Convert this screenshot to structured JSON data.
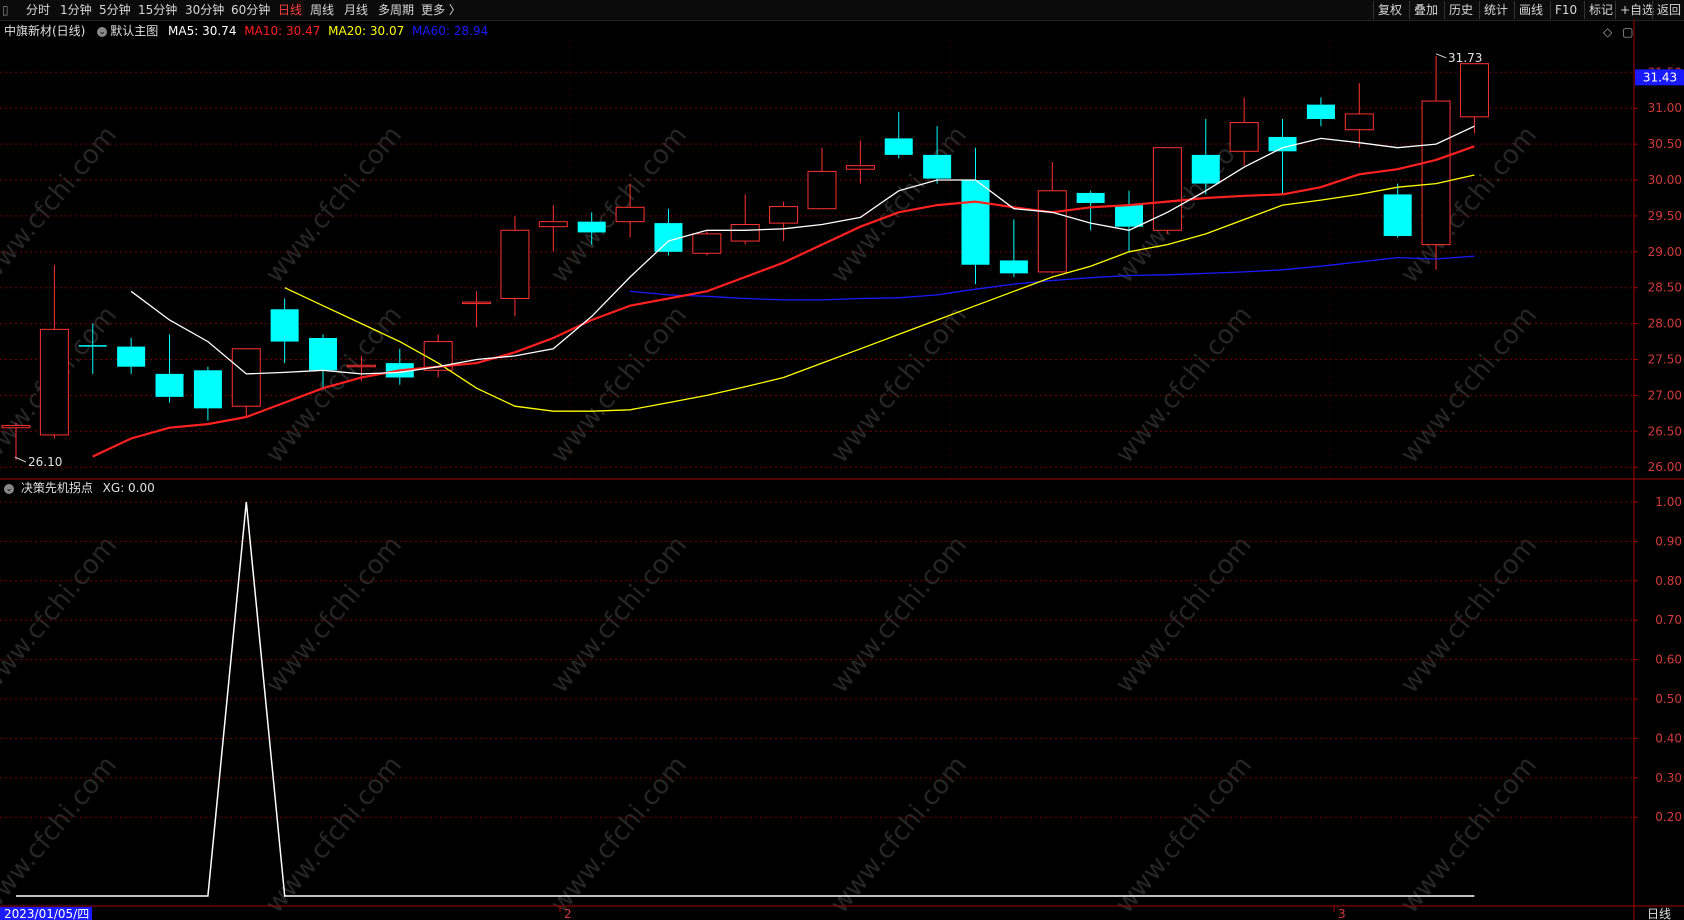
{
  "toolbar": {
    "left_tabs": [
      "分时",
      "1分钟",
      "5分钟",
      "15分钟",
      "30分钟",
      "60分钟",
      "日线",
      "周线",
      "月线",
      "多周期",
      "更多 〉"
    ],
    "active_tab": "日线",
    "right_buttons": [
      "复权",
      "叠加",
      "历史",
      "统计",
      "画线",
      "F10",
      "标记",
      "+自选",
      "返回"
    ]
  },
  "main_chart": {
    "stock_label": "中旗新材(日线)",
    "template_label": "默认主图",
    "ma5": {
      "label": "MA5: 30.74",
      "color": "#ffffff"
    },
    "ma10": {
      "label": "MA10: 30.47",
      "color": "#ff2020"
    },
    "ma20": {
      "label": "MA20: 30.07",
      "color": "#ffff00"
    },
    "ma60": {
      "label": "MA60: 28.94",
      "color": "#1a1aff"
    },
    "current_price_tag": "31.43",
    "high_label": "31.73",
    "low_label": "26.10"
  },
  "indicator": {
    "name_label": "决策先机拐点",
    "value_label": "XG: 0.00"
  },
  "bottom": {
    "date_label": "2023/01/05/四",
    "month_markers": [
      "2",
      "3"
    ],
    "period_label": "日线"
  },
  "watermark": "www.cfchi.com",
  "colors": {
    "up": "#ff3232",
    "down": "#00ffff",
    "grid": "#6e0000",
    "axis": "#aa0000"
  },
  "chart_data": [
    {
      "type": "candlestick",
      "ylim": [
        25.85,
        31.95
      ],
      "yticks": [
        26.0,
        26.5,
        27.0,
        27.5,
        28.0,
        28.5,
        29.0,
        29.5,
        30.0,
        30.5,
        31.0,
        31.5
      ],
      "candles": [
        {
          "o": 26.55,
          "h": 26.62,
          "l": 26.1,
          "c": 26.58
        },
        {
          "o": 26.45,
          "h": 28.82,
          "l": 26.4,
          "c": 27.92
        },
        {
          "o": 27.7,
          "h": 28.0,
          "l": 27.3,
          "c": 27.68
        },
        {
          "o": 27.68,
          "h": 27.8,
          "l": 27.3,
          "c": 27.4
        },
        {
          "o": 27.3,
          "h": 27.85,
          "l": 26.9,
          "c": 26.98
        },
        {
          "o": 27.35,
          "h": 27.4,
          "l": 26.65,
          "c": 26.82
        },
        {
          "o": 26.85,
          "h": 27.65,
          "l": 26.7,
          "c": 27.65
        },
        {
          "o": 28.2,
          "h": 28.35,
          "l": 27.45,
          "c": 27.75
        },
        {
          "o": 27.8,
          "h": 27.85,
          "l": 27.1,
          "c": 27.35
        },
        {
          "o": 27.4,
          "h": 27.55,
          "l": 27.2,
          "c": 27.42
        },
        {
          "o": 27.45,
          "h": 27.65,
          "l": 27.15,
          "c": 27.25
        },
        {
          "o": 27.35,
          "h": 27.85,
          "l": 27.25,
          "c": 27.75
        },
        {
          "o": 28.3,
          "h": 28.45,
          "l": 27.95,
          "c": 28.3
        },
        {
          "o": 28.35,
          "h": 29.5,
          "l": 28.1,
          "c": 29.3
        },
        {
          "o": 29.35,
          "h": 29.65,
          "l": 29.0,
          "c": 29.42
        },
        {
          "o": 29.42,
          "h": 29.55,
          "l": 29.1,
          "c": 29.27
        },
        {
          "o": 29.42,
          "h": 29.95,
          "l": 29.2,
          "c": 29.62
        },
        {
          "o": 29.4,
          "h": 29.6,
          "l": 28.95,
          "c": 29.0
        },
        {
          "o": 28.98,
          "h": 29.3,
          "l": 28.95,
          "c": 29.25
        },
        {
          "o": 29.15,
          "h": 29.8,
          "l": 29.1,
          "c": 29.38
        },
        {
          "o": 29.4,
          "h": 29.7,
          "l": 29.15,
          "c": 29.63
        },
        {
          "o": 29.6,
          "h": 30.45,
          "l": 29.6,
          "c": 30.12
        },
        {
          "o": 30.15,
          "h": 30.55,
          "l": 29.95,
          "c": 30.2
        },
        {
          "o": 30.58,
          "h": 30.95,
          "l": 30.3,
          "c": 30.35
        },
        {
          "o": 30.35,
          "h": 30.75,
          "l": 29.95,
          "c": 30.02
        },
        {
          "o": 30.0,
          "h": 30.45,
          "l": 28.55,
          "c": 28.82
        },
        {
          "o": 28.88,
          "h": 29.45,
          "l": 28.65,
          "c": 28.7
        },
        {
          "o": 28.72,
          "h": 30.25,
          "l": 28.7,
          "c": 29.85
        },
        {
          "o": 29.82,
          "h": 29.85,
          "l": 29.3,
          "c": 29.68
        },
        {
          "o": 29.65,
          "h": 29.85,
          "l": 29.0,
          "c": 29.35
        },
        {
          "o": 29.3,
          "h": 30.45,
          "l": 29.25,
          "c": 30.45
        },
        {
          "o": 30.35,
          "h": 30.85,
          "l": 29.8,
          "c": 29.95
        },
        {
          "o": 30.4,
          "h": 31.15,
          "l": 30.2,
          "c": 30.8
        },
        {
          "o": 30.6,
          "h": 30.85,
          "l": 29.8,
          "c": 30.4
        },
        {
          "o": 31.05,
          "h": 31.15,
          "l": 30.75,
          "c": 30.85
        },
        {
          "o": 30.7,
          "h": 31.35,
          "l": 30.45,
          "c": 30.92
        },
        {
          "o": 29.8,
          "h": 29.95,
          "l": 29.2,
          "c": 29.22
        },
        {
          "o": 29.1,
          "h": 31.73,
          "l": 28.75,
          "c": 31.1
        },
        {
          "o": 30.88,
          "h": 31.62,
          "l": 30.65,
          "c": 31.62
        }
      ],
      "ma5": [
        28.45,
        28.05,
        27.75,
        27.3,
        27.32,
        27.35,
        27.3,
        27.32,
        27.4,
        27.5,
        27.55,
        27.65,
        28.1,
        28.65,
        29.15,
        29.3,
        29.3,
        29.32,
        29.38,
        29.48,
        29.85,
        30.0,
        30.0,
        29.6,
        29.55,
        29.4,
        29.3,
        29.55,
        29.85,
        30.18,
        30.45,
        30.58,
        30.52,
        30.45,
        30.5,
        30.75
      ],
      "ma10": [
        26.15,
        26.4,
        26.55,
        26.6,
        26.7,
        26.9,
        27.1,
        27.25,
        27.35,
        27.4,
        27.45,
        27.6,
        27.8,
        28.05,
        28.25,
        28.35,
        28.45,
        28.65,
        28.85,
        29.1,
        29.35,
        29.55,
        29.65,
        29.7,
        29.62,
        29.55,
        29.62,
        29.65,
        29.7,
        29.75,
        29.78,
        29.8,
        29.9,
        30.08,
        30.15,
        30.28,
        30.47
      ],
      "ma20": [
        28.5,
        28.25,
        28.0,
        27.75,
        27.45,
        27.1,
        26.85,
        26.78,
        26.78,
        26.8,
        26.9,
        27.0,
        27.12,
        27.25,
        27.45,
        27.65,
        27.85,
        28.05,
        28.25,
        28.45,
        28.65,
        28.8,
        29.0,
        29.1,
        29.25,
        29.45,
        29.65,
        29.72,
        29.8,
        29.9,
        29.95,
        30.07
      ],
      "ma60": [
        28.45,
        28.4,
        28.38,
        28.35,
        28.33,
        28.33,
        28.35,
        28.36,
        28.4,
        28.48,
        28.55,
        28.6,
        28.64,
        28.67,
        28.68,
        28.7,
        28.72,
        28.75,
        28.8,
        28.86,
        28.92,
        28.9,
        28.94
      ]
    },
    {
      "type": "line",
      "series": [
        {
          "name": "XG",
          "values": [
            0,
            0,
            0,
            0,
            0,
            0,
            1,
            0,
            0,
            0,
            0,
            0,
            0,
            0,
            0,
            0,
            0,
            0,
            0,
            0,
            0,
            0,
            0,
            0,
            0,
            0,
            0,
            0,
            0,
            0,
            0,
            0,
            0,
            0,
            0,
            0,
            0,
            0,
            0
          ]
        }
      ],
      "ylim": [
        0,
        1.0
      ],
      "yticks": [
        0.2,
        0.3,
        0.4,
        0.5,
        0.6,
        0.7,
        0.8,
        0.9,
        1.0
      ]
    }
  ]
}
